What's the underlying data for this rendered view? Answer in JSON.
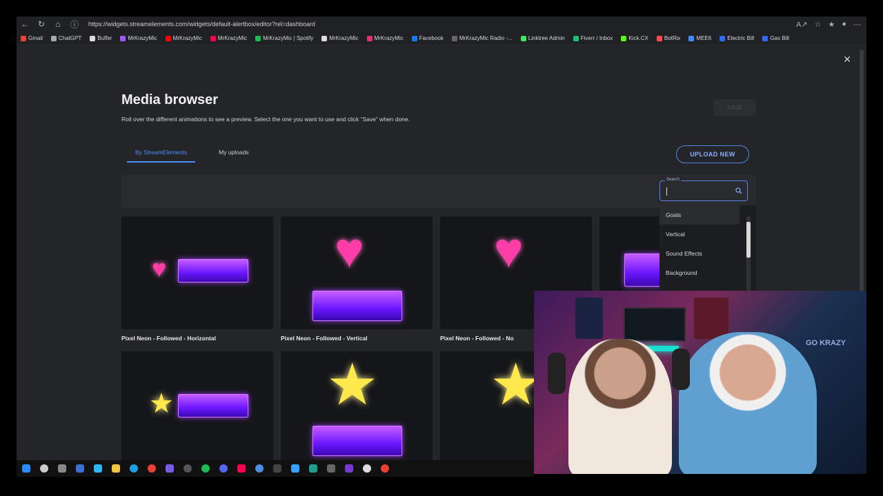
{
  "browser": {
    "url": "https://widgets.streamelements.com/widgets/default-alertbox/editor?rel=dashboard",
    "bookmarks": [
      "Gmail",
      "ChatGPT",
      "Buffer",
      "MrKrazyMic",
      "MrKrazyMic",
      "MrKrazyMic",
      "MrKrazyMic | Spotify",
      "MrKrazyMic",
      "MrKrazyMic",
      "Facebook",
      "MrKrazyMic Radio -...",
      "Linktree Admin",
      "Fiverr / Inbox",
      "Kick.CX",
      "BotRix",
      "MEE6",
      "Electric Bill",
      "Gas Bill"
    ],
    "bookmark_colors": [
      "#ea4335",
      "#aaa",
      "#ddd",
      "#9b59ff",
      "#ff0000",
      "#ff0050",
      "#1db954",
      "#ddd",
      "#e1306c",
      "#1877f2",
      "#666",
      "#43e55e",
      "#1dbf73",
      "#53fc18",
      "#ff4d4d",
      "#3f8cff",
      "#2e6cf6",
      "#2e6cf6"
    ]
  },
  "modal": {
    "title": "Media browser",
    "subtitle": "Roll over the different animations to see a preview. Select the one you want to use and click “Save” when done.",
    "save_label": "SAVE",
    "upload_label": "UPLOAD NEW",
    "tabs": [
      {
        "label": "By StreamElements",
        "active": true
      },
      {
        "label": "My uploads",
        "active": false
      }
    ],
    "search": {
      "label": "Search",
      "value": ""
    },
    "dropdown": [
      "Goals",
      "Vertical",
      "Sound Effects",
      "Background"
    ],
    "cards": [
      {
        "label": "Pixel Neon - Followed - Horizontal"
      },
      {
        "label": "Pixel Neon - Followed - Vertical"
      },
      {
        "label": "Pixel Neon - Followed - No"
      }
    ]
  },
  "webcam": {
    "logo_text": "GO KRAZY"
  },
  "colors": {
    "accent": "#4c8fff",
    "background": "#232528"
  }
}
